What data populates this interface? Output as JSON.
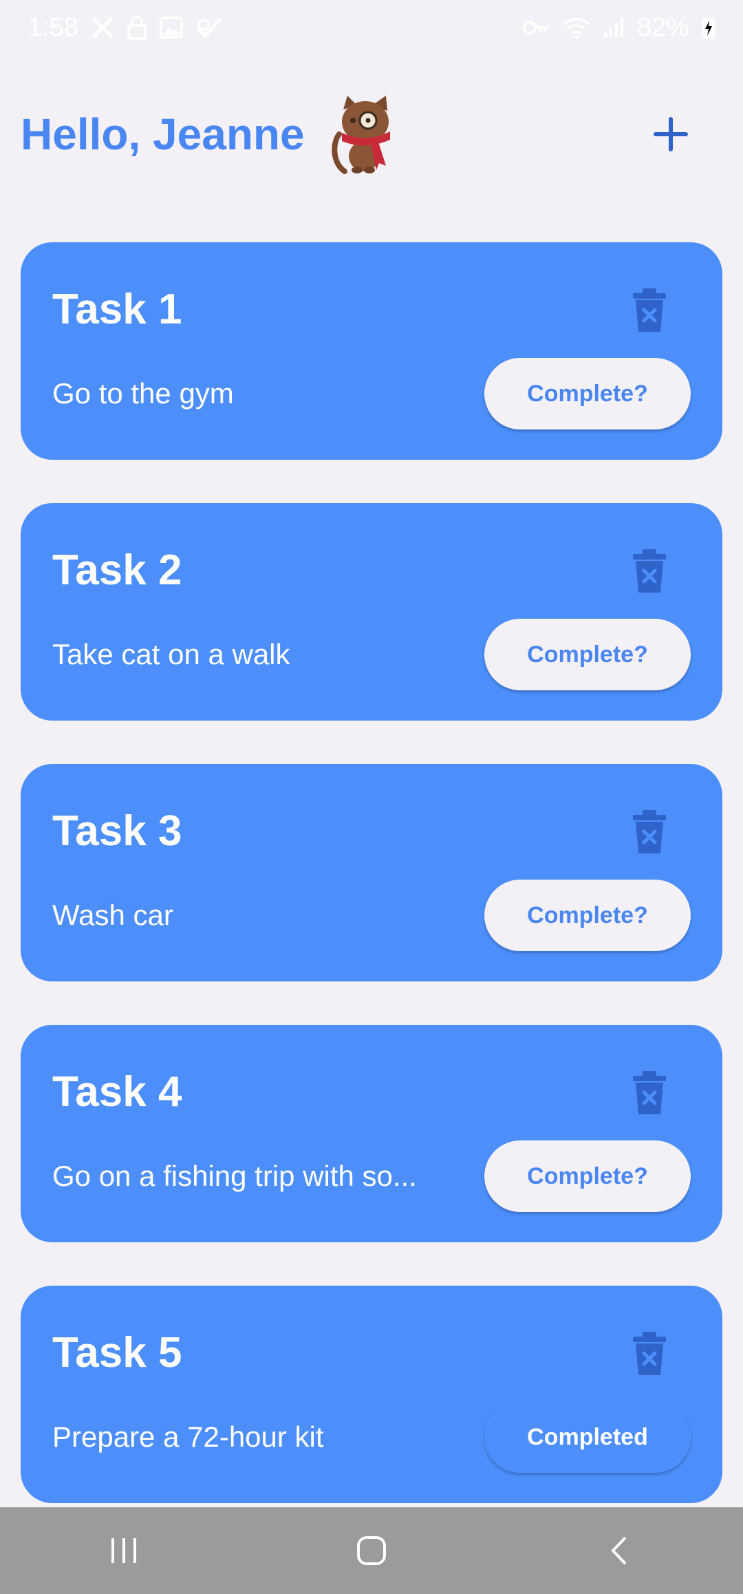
{
  "status_bar": {
    "time": "1:58",
    "battery": "82%",
    "icons": [
      "x-app-icon",
      "lock-icon",
      "gallery-icon",
      "check-badge-icon",
      "key-icon",
      "wifi-icon",
      "signal-icon",
      "battery-charging-icon"
    ]
  },
  "header": {
    "greeting": "Hello, Jeanne",
    "avatar_icon": "cat-avatar-icon",
    "add_icon": "plus-icon"
  },
  "colors": {
    "background": "#f3f1f6",
    "card": "#4c8ffb",
    "accent": "#4a86f2",
    "trash": "#2f63c9"
  },
  "tasks": [
    {
      "title": "Task 1",
      "description": "Go to the gym",
      "button": "Complete?",
      "completed": false
    },
    {
      "title": "Task 2",
      "description": "Take cat on a walk",
      "button": "Complete?",
      "completed": false
    },
    {
      "title": "Task 3",
      "description": "Wash car",
      "button": "Complete?",
      "completed": false
    },
    {
      "title": "Task 4",
      "description": "Go on a fishing trip with so...",
      "button": "Complete?",
      "completed": false
    },
    {
      "title": "Task 5",
      "description": "Prepare a 72-hour kit",
      "button": "Completed",
      "completed": true
    }
  ],
  "nav_bar": {
    "icons": [
      "recent-apps-icon",
      "home-icon",
      "back-icon"
    ]
  }
}
